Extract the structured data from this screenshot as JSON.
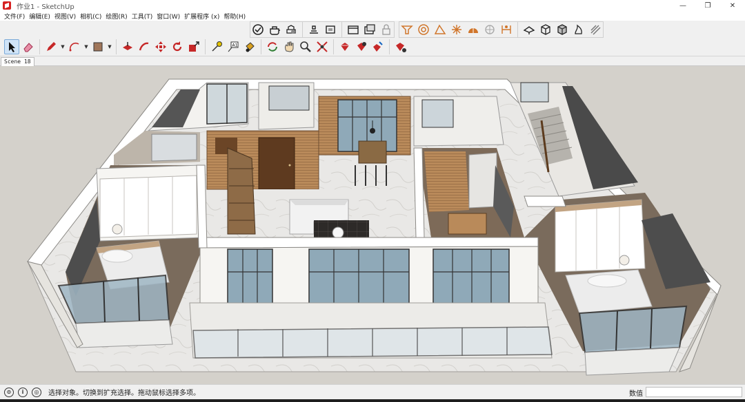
{
  "window": {
    "title": "作业1 - SketchUp",
    "minimize": "—",
    "maximize": "❐",
    "close": "✕"
  },
  "menu": [
    "文件(F)",
    "编辑(E)",
    "视图(V)",
    "相机(C)",
    "绘图(R)",
    "工具(T)",
    "窗口(W)",
    "扩展程序 (x)",
    "帮助(H)"
  ],
  "toolbars": {
    "row1_groups": [
      {
        "name": "styles",
        "icons": [
          "xray-icon",
          "back-edges-icon",
          "wireframe-icon"
        ]
      },
      {
        "name": "views",
        "icons": [
          "iso-view-icon",
          "top-view-icon"
        ]
      },
      {
        "name": "sections",
        "icons": [
          "section-plane-icon",
          "section-cut-icon",
          "lock-icon"
        ]
      },
      {
        "name": "extensions",
        "icons": [
          "plugin-a-icon",
          "plugin-b-icon",
          "protractor-icon",
          "sun-icon",
          "dome-icon",
          "sphere-icon",
          "dimension-icon",
          "camera-rig-icon",
          "cube-icon",
          "cube-solid-icon",
          "flame-icon",
          "striped-icon"
        ]
      }
    ],
    "row2": [
      "select-icon",
      "eraser-icon",
      "pencil-icon",
      "arc-icon",
      "paint-icon",
      "push-pull-icon",
      "follow-me-icon",
      "move-icon",
      "rotate-icon",
      "scale-icon",
      "tape-icon",
      "text-icon",
      "paint-bucket-icon",
      "orbit-icon",
      "pan-icon",
      "zoom-icon",
      "zoom-extents-icon",
      "ruby-a-icon",
      "ruby-b-icon",
      "ruby-c-icon",
      "ruby-d-icon"
    ]
  },
  "scenes": [
    {
      "label": "Scene 18",
      "active": true
    }
  ],
  "status": {
    "hint": "选择对象。切换到扩充选择。拖动鼠标选择多项。",
    "measure_label": "数值",
    "measure_value": ""
  },
  "colors": {
    "viewport_bg": "#d4d1cb",
    "wall_top": "#ffffff",
    "wall_side": "#e8e6e2",
    "floor_marble": "#e9e8e6",
    "wood": "#b98a5a",
    "glass": "#9fb6c4",
    "dark_wall": "#4d4d4d",
    "accent_red": "#d62020"
  }
}
